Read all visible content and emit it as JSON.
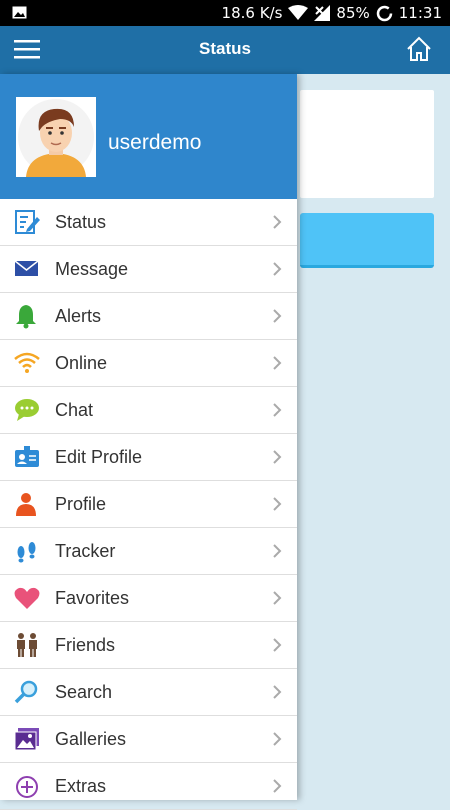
{
  "status_bar": {
    "speed": "18.6 K/s",
    "battery": "85%",
    "time": "11:31"
  },
  "app_bar": {
    "title": "Status"
  },
  "drawer": {
    "username": "userdemo",
    "items": [
      {
        "label": "Status",
        "icon": "edit-icon"
      },
      {
        "label": "Message",
        "icon": "envelope-icon"
      },
      {
        "label": "Alerts",
        "icon": "bell-icon"
      },
      {
        "label": "Online",
        "icon": "wifi-icon"
      },
      {
        "label": "Chat",
        "icon": "chat-icon"
      },
      {
        "label": "Edit Profile",
        "icon": "id-card-icon"
      },
      {
        "label": "Profile",
        "icon": "person-icon"
      },
      {
        "label": "Tracker",
        "icon": "footprints-icon"
      },
      {
        "label": "Favorites",
        "icon": "heart-icon"
      },
      {
        "label": "Friends",
        "icon": "friends-icon"
      },
      {
        "label": "Search",
        "icon": "search-icon"
      },
      {
        "label": "Galleries",
        "icon": "gallery-icon"
      },
      {
        "label": "Extras",
        "icon": "plus-circle-icon"
      }
    ]
  },
  "colors": {
    "app_bar": "#1f6fa6",
    "drawer_header": "#2f86cc",
    "content_button": "#4fc3f7",
    "background": "#d7e9f1"
  }
}
